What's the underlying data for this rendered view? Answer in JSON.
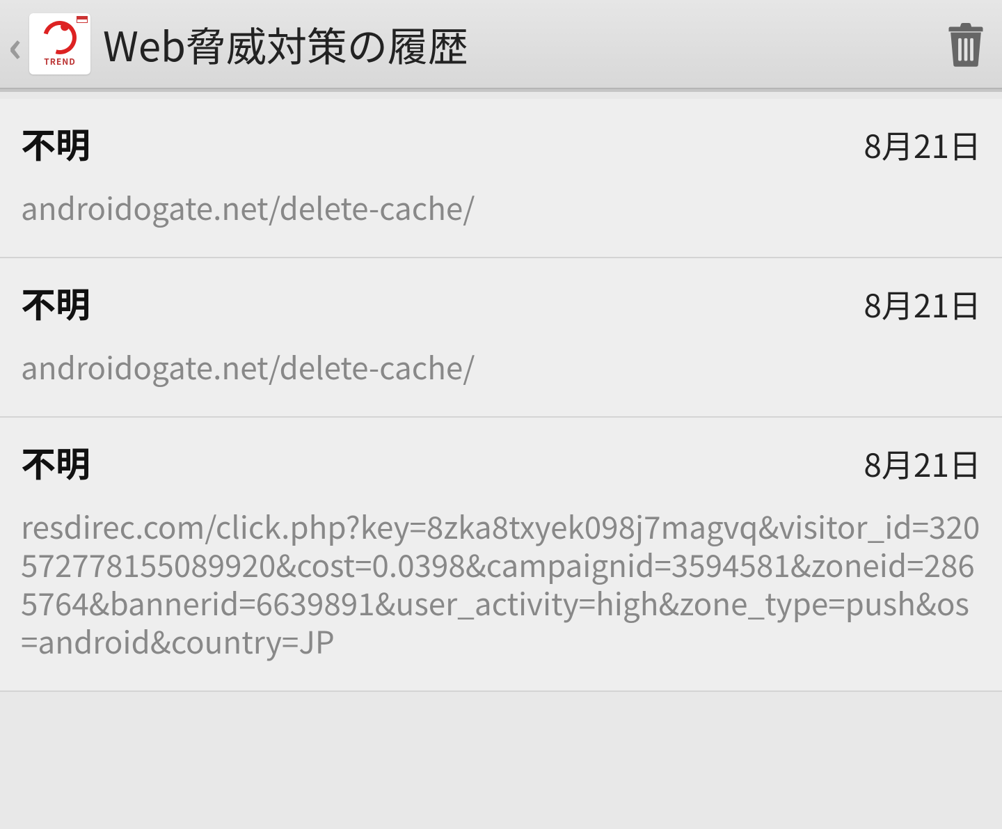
{
  "header": {
    "back_glyph": "‹",
    "app_icon_label": "TREND",
    "title": "Web脅威対策の履歴"
  },
  "history": [
    {
      "title": "不明",
      "date": "8月21日",
      "url": "androidogate.net/delete-cache/"
    },
    {
      "title": "不明",
      "date": "8月21日",
      "url": "androidogate.net/delete-cache/"
    },
    {
      "title": "不明",
      "date": "8月21日",
      "url": "resdirec.com/click.php?key=8zka8txyek098j7magvq&visitor_id=320572778155089920&cost=0.0398&campaignid=3594581&zoneid=2865764&bannerid=6639891&user_activity=high&zone_type=push&os=android&country=JP"
    }
  ]
}
